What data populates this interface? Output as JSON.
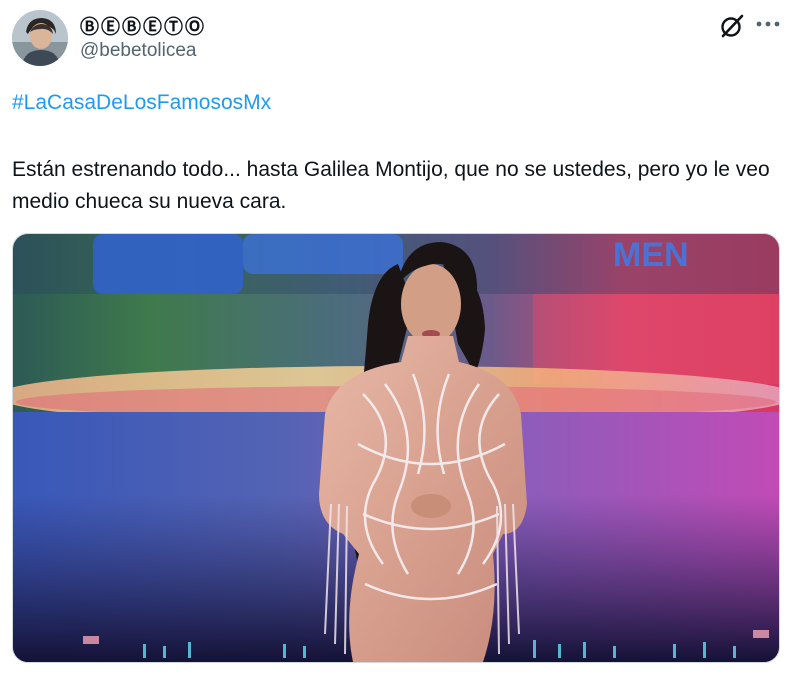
{
  "author": {
    "display_name": "ⒷⒺⒷⒺⓉⓄ",
    "handle": "@bebetolicea"
  },
  "post": {
    "hashtag": "#LaCasaDeLosFamososMx",
    "text": "Están estrenando todo... hasta Galilea Montijo, que no se ustedes, pero yo le veo medio chueca su nueva cara."
  },
  "icons": {
    "avatar": "user-avatar",
    "grok": "grok-icon",
    "more": "more-options-icon"
  },
  "colors": {
    "link": "#1d9bf0",
    "text": "#0f1419",
    "secondary": "#536471"
  }
}
